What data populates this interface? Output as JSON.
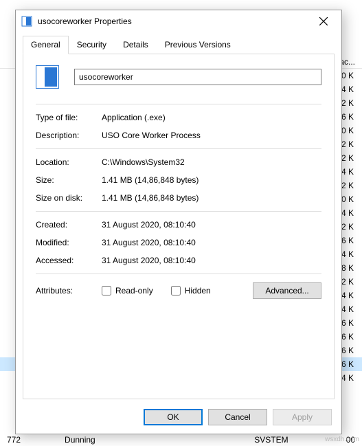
{
  "dialog": {
    "title": "usocoreworker Properties",
    "tabs": [
      "General",
      "Security",
      "Details",
      "Previous Versions"
    ],
    "active_tab": "General",
    "filename": "usocoreworker",
    "fields": {
      "type_label": "Type of file:",
      "type_value": "Application (.exe)",
      "desc_label": "Description:",
      "desc_value": "USO Core Worker Process",
      "loc_label": "Location:",
      "loc_value": "C:\\Windows\\System32",
      "size_label": "Size:",
      "size_value": "1.41 MB (14,86,848 bytes)",
      "sizeod_label": "Size on disk:",
      "sizeod_value": "1.41 MB (14,86,848 bytes)",
      "created_label": "Created:",
      "created_value": "31 August 2020, 08:10:40",
      "modified_label": "Modified:",
      "modified_value": "31 August 2020, 08:10:40",
      "accessed_label": "Accessed:",
      "accessed_value": "31 August 2020, 08:10:40",
      "attr_label": "Attributes:",
      "readonly_label": "Read-only",
      "hidden_label": "Hidden",
      "advanced_label": "Advanced..."
    },
    "buttons": {
      "ok": "OK",
      "cancel": "Cancel",
      "apply": "Apply"
    }
  },
  "background": {
    "header": "ac...",
    "rows": [
      "0 K",
      "4 K",
      "2 K",
      "6 K",
      "0 K",
      "2 K",
      "2 K",
      "4 K",
      "2 K",
      "0 K",
      "4 K",
      "2 K",
      "6 K",
      "4 K",
      "8 K",
      "2 K",
      "4 K",
      "4 K",
      "6 K",
      "6 K",
      "6 K",
      "6 K",
      "4 K"
    ],
    "selected_index": 21,
    "footer_pid": "772",
    "footer_status": "Dunning",
    "footer_user": "SVSTEM",
    "footer_time": "00"
  },
  "watermark": "wsxdh.com"
}
